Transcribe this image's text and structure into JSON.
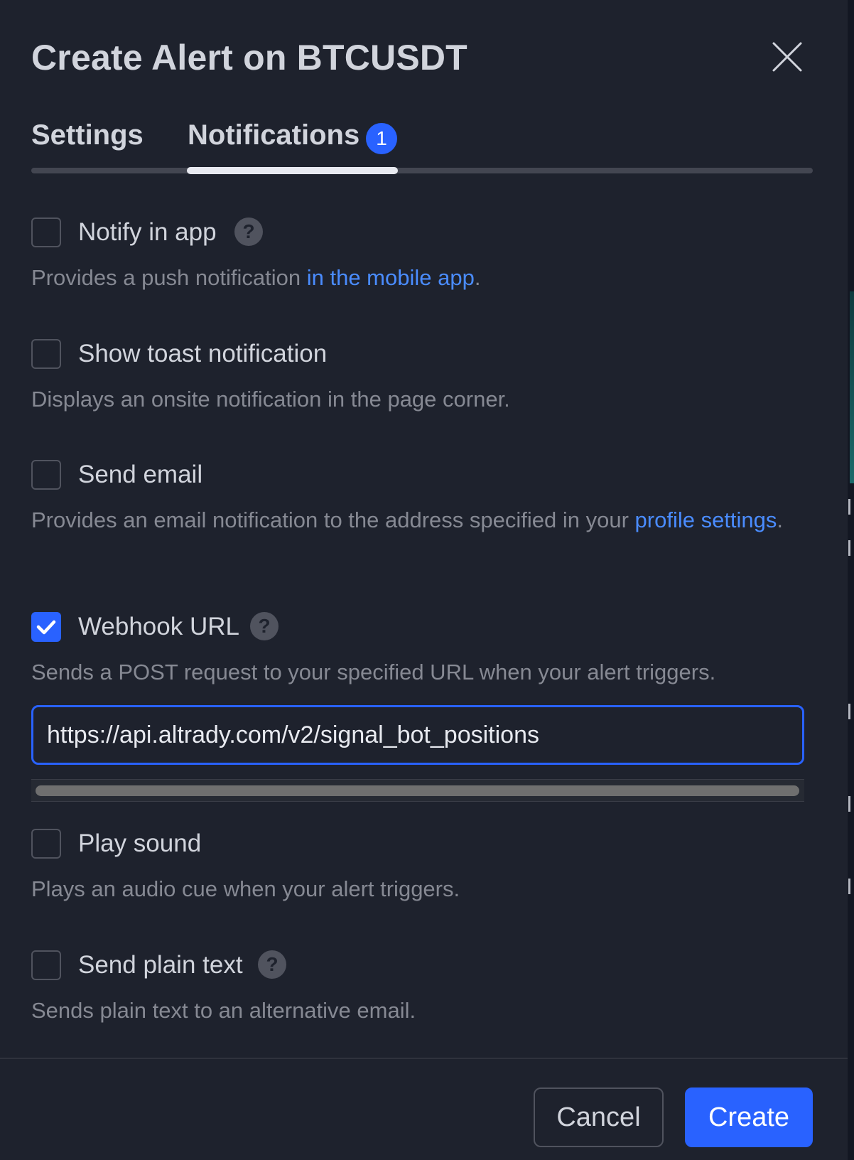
{
  "dialog": {
    "title": "Create Alert on BTCUSDT",
    "close_icon": "close-icon"
  },
  "tabs": [
    {
      "label": "Settings",
      "active": false
    },
    {
      "label": "Notifications",
      "active": true,
      "badge": "1"
    }
  ],
  "options": {
    "notify_in_app": {
      "label": "Notify in app",
      "checked": false,
      "has_help": true,
      "desc_prefix": "Provides a push notification ",
      "desc_link": "in the mobile app",
      "desc_suffix": "."
    },
    "show_toast": {
      "label": "Show toast notification",
      "checked": false,
      "desc": "Displays an onsite notification in the page corner."
    },
    "send_email": {
      "label": "Send email",
      "checked": false,
      "desc_prefix": "Provides an email notification to the address specified in your ",
      "desc_link": "profile settings",
      "desc_suffix": "."
    },
    "webhook": {
      "label": "Webhook URL",
      "checked": true,
      "has_help": true,
      "desc": "Sends a POST request to your specified URL when your alert triggers.",
      "url_value": "https://api.altrady.com/v2/signal_bot_positions"
    },
    "play_sound": {
      "label": "Play sound",
      "checked": false,
      "desc": "Plays an audio cue when your alert triggers."
    },
    "plain_text": {
      "label": "Send plain text",
      "checked": false,
      "has_help": true,
      "desc": "Sends plain text to an alternative email."
    }
  },
  "footer": {
    "cancel_label": "Cancel",
    "create_label": "Create"
  },
  "icons": {
    "help": "?",
    "check": "checkmark-icon"
  },
  "colors": {
    "background": "#1e222d",
    "accent": "#2962ff",
    "link": "#4a8cff",
    "text": "#d1d4dc",
    "muted": "#868993"
  }
}
